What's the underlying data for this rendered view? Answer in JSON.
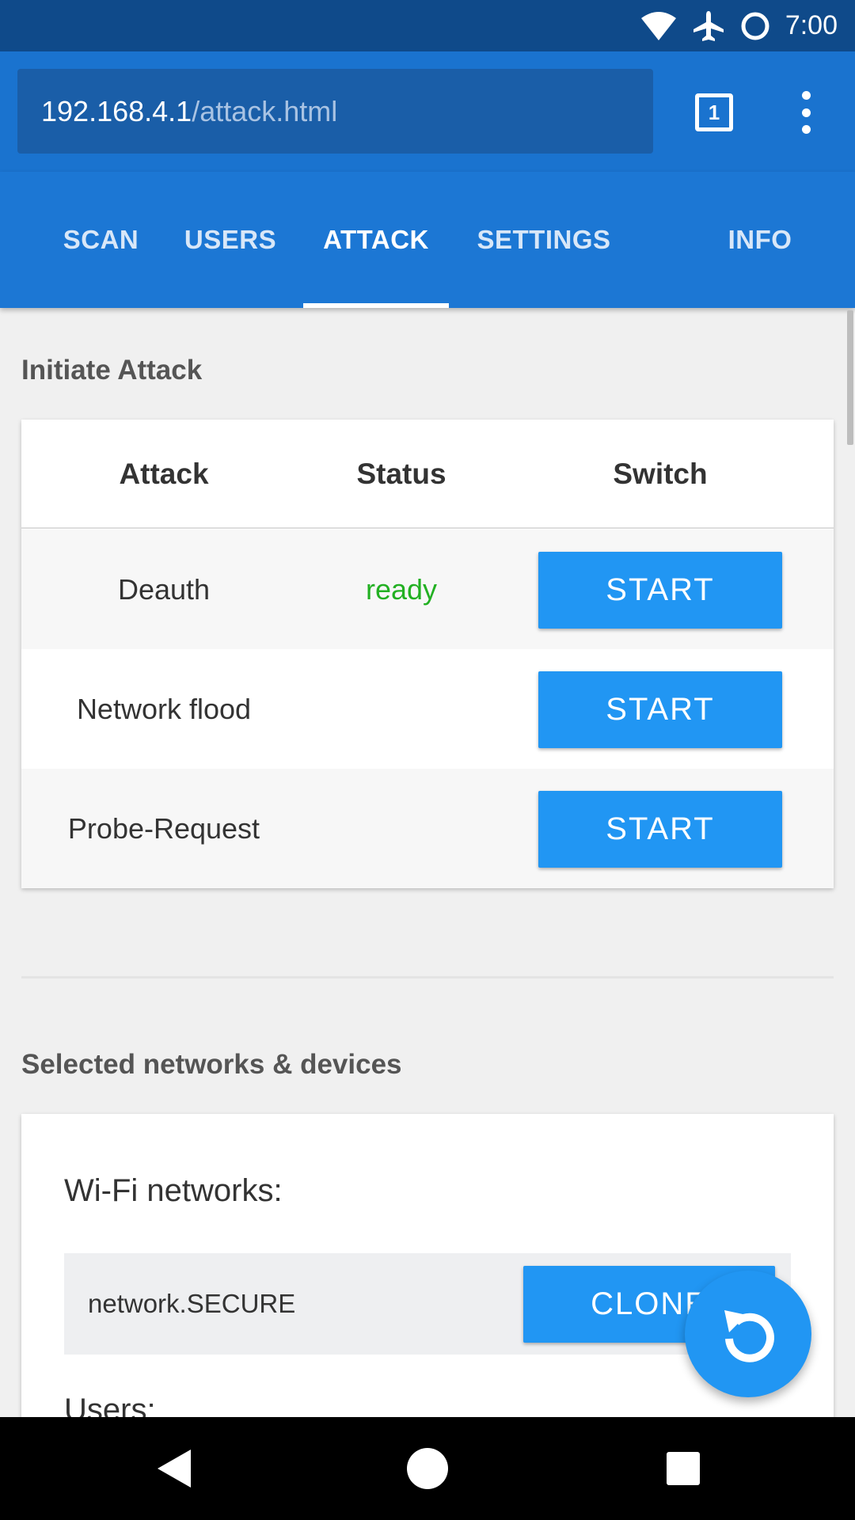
{
  "status_bar": {
    "time": "7:00",
    "icons": [
      "wifi-icon",
      "airplane-icon",
      "sync-ring-icon"
    ]
  },
  "browser": {
    "url_host": "192.168.4.1",
    "url_path": "/attack.html",
    "tab_count": "1",
    "menu_icon": "more-vert-icon"
  },
  "nav": {
    "items": [
      {
        "label": "SCAN"
      },
      {
        "label": "USERS"
      },
      {
        "label": "ATTACK"
      },
      {
        "label": "SETTINGS"
      },
      {
        "label": "INFO"
      }
    ],
    "active": "ATTACK"
  },
  "attack_section": {
    "title": "Initiate Attack",
    "headers": {
      "attack": "Attack",
      "status": "Status",
      "switch": "Switch"
    },
    "rows": [
      {
        "name": "Deauth",
        "status": "ready",
        "button": "START"
      },
      {
        "name": "Network flood",
        "status": "",
        "button": "START"
      },
      {
        "name": "Probe-Request",
        "status": "",
        "button": "START"
      }
    ]
  },
  "selected_section": {
    "title": "Selected networks & devices",
    "wifi_heading": "Wi-Fi networks:",
    "networks": [
      {
        "name": "network.SECURE",
        "button": "CLONE"
      }
    ],
    "users_heading": "Users:"
  },
  "fab": {
    "icon": "reload-icon"
  },
  "system_nav": {
    "icons": [
      "back-icon",
      "home-icon",
      "recents-icon"
    ]
  },
  "colors": {
    "status_bar": "#0f4a8a",
    "toolbar": "#1a73cf",
    "nav": "#1c77d4",
    "button": "#2196f3",
    "ready": "#22b022"
  }
}
